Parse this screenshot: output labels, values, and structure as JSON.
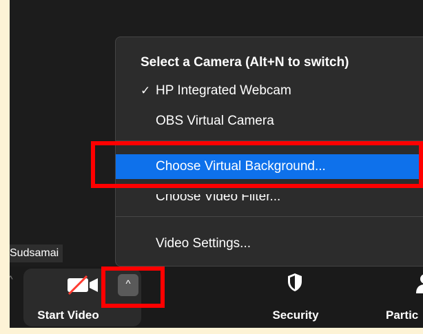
{
  "camera_menu": {
    "header": "Select a Camera (Alt+N to switch)",
    "cameras": [
      {
        "label": "HP Integrated Webcam",
        "selected": true
      },
      {
        "label": "OBS Virtual Camera",
        "selected": false
      }
    ],
    "check_glyph": "✓",
    "items": [
      {
        "label": "Choose Virtual Background...",
        "highlighted": true
      },
      {
        "label": "Choose Video Filter...",
        "highlighted": false
      }
    ],
    "settings_label": "Video Settings..."
  },
  "participant_name": "Sudsamai",
  "toolbar": {
    "start_video_label": "Start Video",
    "caret_glyph": "^",
    "security_label": "Security",
    "participants_label": "Partic",
    "left_chevron": "^"
  },
  "colors": {
    "highlight": "#0e71eb",
    "annotation_red": "#ff0000",
    "menu_bg": "#2c2c2c",
    "toolbar_bg": "#1a1a1a",
    "border_bg": "#fdf3d6"
  },
  "icons": {
    "video_off": "video-off-icon",
    "caret": "caret-up-icon",
    "security": "shield-icon",
    "participants": "person-icon",
    "check": "checkmark-icon"
  }
}
